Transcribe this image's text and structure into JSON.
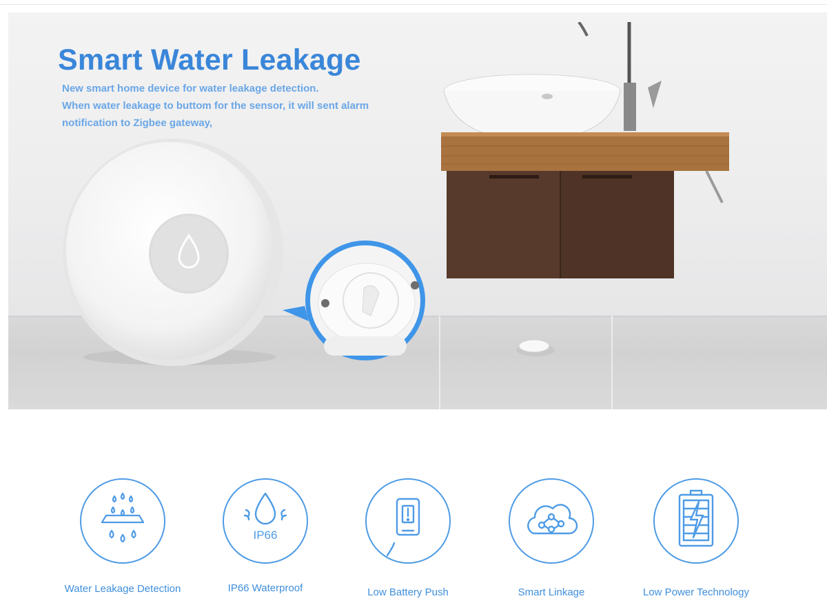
{
  "banner": {
    "title": "Smart Water Leakage",
    "description_lines": [
      "New smart home device for water leakage detection.",
      "When water leakage to buttom for the sensor, it will sent alarm",
      "notification to Zigbee gateway,"
    ]
  },
  "features": [
    {
      "label": "Water Leakage Detection",
      "icon": "water-drops-icon"
    },
    {
      "label": "IP66 Waterproof",
      "icon": "waterproof-drop-icon",
      "badge": "IP66"
    },
    {
      "label": "Low Battery Push",
      "icon": "low-battery-phone-icon"
    },
    {
      "label": "Smart Linkage",
      "icon": "cloud-network-icon"
    },
    {
      "label": "Low Power Technology",
      "icon": "battery-charge-icon"
    }
  ],
  "colors": {
    "accent": "#3a86d9",
    "icon_stroke": "#4e9be6",
    "background": "#ffffff"
  }
}
